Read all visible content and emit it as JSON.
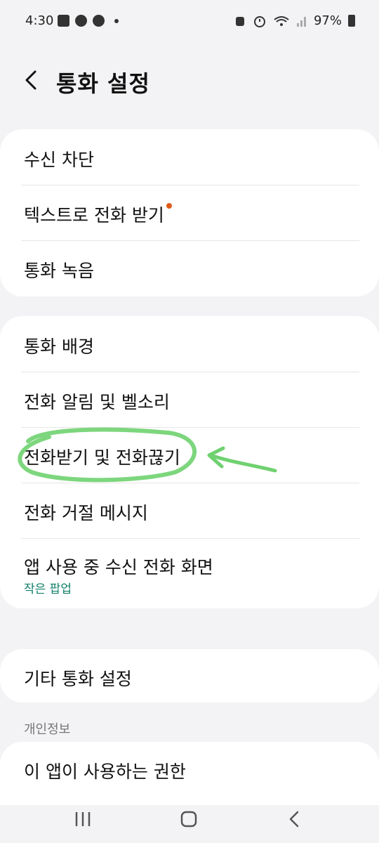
{
  "status_bar": {
    "time": "4:30",
    "battery": "97%",
    "icons": [
      "gallery-icon",
      "power-saving-icon",
      "c-icon",
      "dot-icon",
      "notification-icon",
      "alarm-icon",
      "wifi-icon",
      "signal-icon",
      "battery-icon"
    ]
  },
  "header": {
    "title": "통화 설정",
    "back_icon": "chevron-left-icon"
  },
  "groups": [
    {
      "items": [
        {
          "label": "수신 차단"
        },
        {
          "label": "텍스트로 전화 받기",
          "badge": "new-dot"
        },
        {
          "label": "통화 녹음"
        }
      ]
    },
    {
      "items": [
        {
          "label": "통화 배경"
        },
        {
          "label": "전화 알림 및 벨소리"
        },
        {
          "label": "전화받기 및 전화끊기"
        },
        {
          "label": "전화 거절 메시지"
        },
        {
          "label": "앱 사용 중 수신 전화 화면",
          "subtitle": "작은 팝업"
        }
      ]
    },
    {
      "items": [
        {
          "label": "기타 통화 설정"
        }
      ]
    }
  ],
  "privacy": {
    "section_title": "개인정보",
    "items": [
      {
        "label": "이 앱이 사용하는 권한"
      }
    ]
  },
  "annotation": {
    "color": "#6fd16f",
    "marks": [
      "green-circle-annotation",
      "green-arrow-annotation"
    ]
  },
  "nav_bar": {
    "icons": [
      "recents-icon",
      "home-icon",
      "back-icon"
    ]
  },
  "colors": {
    "background": "#f3f3f5",
    "card": "#ffffff",
    "accent_subtitle": "#12806a",
    "badge": "#e05a1a"
  }
}
